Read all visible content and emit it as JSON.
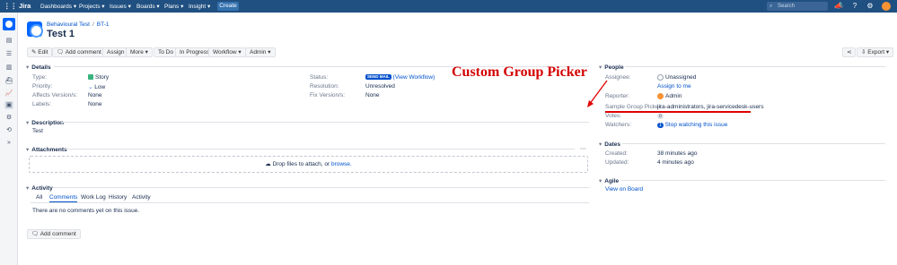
{
  "topbar": {
    "logo": "Jira",
    "nav": [
      "Dashboards",
      "Projects",
      "Issues",
      "Boards",
      "Plans",
      "Insight"
    ],
    "create": "Create",
    "search_placeholder": "Search"
  },
  "breadcrumb": {
    "project": "Behavioural Test",
    "issue_key": "BT-1"
  },
  "issue_title": "Test 1",
  "toolbar": {
    "edit": "Edit",
    "add_comment": "Add comment",
    "assign": "Assign",
    "more": "More",
    "todo": "To Do",
    "in_progress": "In Progress",
    "workflow": "Workflow",
    "admin": "Admin",
    "export": "Export"
  },
  "details": {
    "heading": "Details",
    "type_label": "Type:",
    "type_value": "Story",
    "priority_label": "Priority:",
    "priority_value": "Low",
    "affects_label": "Affects Version/s:",
    "affects_value": "None",
    "labels_label": "Labels:",
    "labels_value": "None",
    "status_label": "Status:",
    "status_badge": "SEND MAIL",
    "status_link": "(View Workflow)",
    "resolution_label": "Resolution:",
    "resolution_value": "Unresolved",
    "fix_label": "Fix Version/s:",
    "fix_value": "None"
  },
  "description": {
    "heading": "Description",
    "text": "Test"
  },
  "attachments": {
    "heading": "Attachments",
    "drop_text": "Drop files to attach, or",
    "browse": "browse."
  },
  "activity": {
    "heading": "Activity",
    "tabs": [
      "All",
      "Comments",
      "Work Log",
      "History",
      "Activity"
    ],
    "active_tab": "Comments",
    "empty": "There are no comments yet on this issue.",
    "add_comment": "Add comment"
  },
  "people": {
    "heading": "People",
    "assignee_label": "Assignee:",
    "assignee_value": "Unassigned",
    "assign_to_me": "Assign to me",
    "reporter_label": "Reporter:",
    "reporter_value": "Admin",
    "group_picker_label": "Sample Group Picker:",
    "group_picker_value": "jira-administrators, jira-servicedesk-users",
    "votes_label": "Votes:",
    "votes_value": "0",
    "watchers_label": "Watchers:",
    "watchers_count": "1",
    "watchers_link": "Stop watching this issue"
  },
  "dates": {
    "heading": "Dates",
    "created_label": "Created:",
    "created_value": "38 minutes ago",
    "updated_label": "Updated:",
    "updated_value": "4 minutes ago"
  },
  "agile": {
    "heading": "Agile",
    "view_on_board": "View on Board"
  },
  "annotation": {
    "text": "Custom Group Picker",
    "color": "#d40000"
  },
  "colors": {
    "topbar": "#205081",
    "link": "#0052cc",
    "accent": "#3572b0"
  }
}
